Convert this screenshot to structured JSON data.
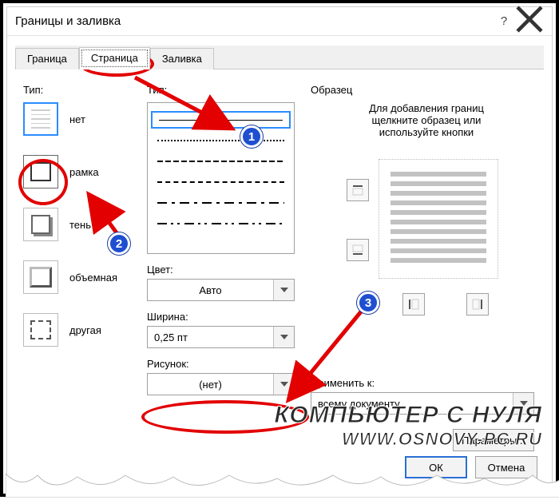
{
  "titlebar": {
    "title": "Границы и заливка"
  },
  "tabs": {
    "t0": "Граница",
    "t1": "Страница",
    "t2": "Заливка"
  },
  "left": {
    "label": "Тип:",
    "items": {
      "none": "нет",
      "frame": "рамка",
      "shadow": "тень",
      "volume": "объемная",
      "art": "другая"
    }
  },
  "middle": {
    "type_label": "Тип:",
    "color_label": "Цвет:",
    "color_value": "Авто",
    "width_label": "Ширина:",
    "width_value": "0,25 пт",
    "picture_label": "Рисунок:",
    "picture_value": "(нет)"
  },
  "right": {
    "label": "Образец",
    "hint1": "Для добавления границ",
    "hint2": "щелкните образец или",
    "hint3": "используйте кнопки",
    "apply_label": "Применить к:",
    "apply_value": "всему документу",
    "params": "Параметры..."
  },
  "footer": {
    "ok": "ОК",
    "cancel": "Отмена"
  },
  "badges": {
    "b1": "1",
    "b2": "2",
    "b3": "3"
  },
  "watermark": {
    "l1": "КОМПЬЮТЕР С НУЛЯ",
    "l2": "WWW.OSNOVY-PC.RU"
  }
}
